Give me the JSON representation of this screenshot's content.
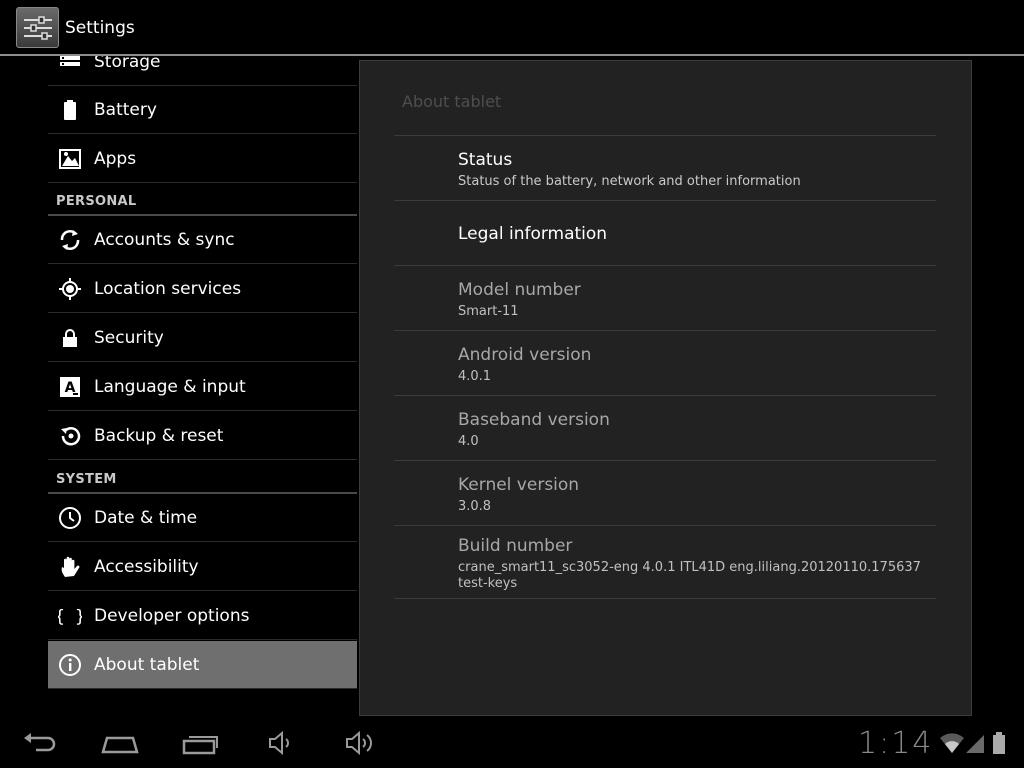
{
  "app": {
    "title": "Settings"
  },
  "sidebar": {
    "items": [
      {
        "label": "Storage",
        "icon": "storage-icon"
      },
      {
        "label": "Battery",
        "icon": "battery-icon"
      },
      {
        "label": "Apps",
        "icon": "apps-icon"
      },
      {
        "header": "PERSONAL"
      },
      {
        "label": "Accounts & sync",
        "icon": "sync-icon"
      },
      {
        "label": "Location services",
        "icon": "location-icon"
      },
      {
        "label": "Security",
        "icon": "lock-icon"
      },
      {
        "label": "Language & input",
        "icon": "language-icon"
      },
      {
        "label": "Backup & reset",
        "icon": "backup-icon"
      },
      {
        "header": "SYSTEM"
      },
      {
        "label": "Date & time",
        "icon": "clock-icon"
      },
      {
        "label": "Accessibility",
        "icon": "hand-icon"
      },
      {
        "label": "Developer options",
        "icon": "braces-icon"
      },
      {
        "label": "About tablet",
        "icon": "info-icon",
        "selected": true
      }
    ]
  },
  "panel": {
    "title": "About tablet",
    "rows": [
      {
        "title": "Status",
        "summary": "Status of the battery, network and other information",
        "enabled": true
      },
      {
        "title": "Legal information",
        "enabled": true
      },
      {
        "title": "Model number",
        "summary": "Smart-11",
        "enabled": false
      },
      {
        "title": "Android version",
        "summary": "4.0.1",
        "enabled": false
      },
      {
        "title": "Baseband version",
        "summary": "4.0",
        "enabled": false
      },
      {
        "title": "Kernel version",
        "summary": "3.0.8",
        "enabled": false
      },
      {
        "title": "Build number",
        "summary_line1": "crane_smart11_sc3052-eng 4.0.1 ITL41D eng.liliang.20120110.175637",
        "summary_line2": "test-keys",
        "enabled": false
      }
    ]
  },
  "statusbar": {
    "clock": "1:14"
  },
  "colors": {
    "selected": "#6f6f6f",
    "panel_bg": "#222222",
    "header_text": "#c8c8c8"
  }
}
